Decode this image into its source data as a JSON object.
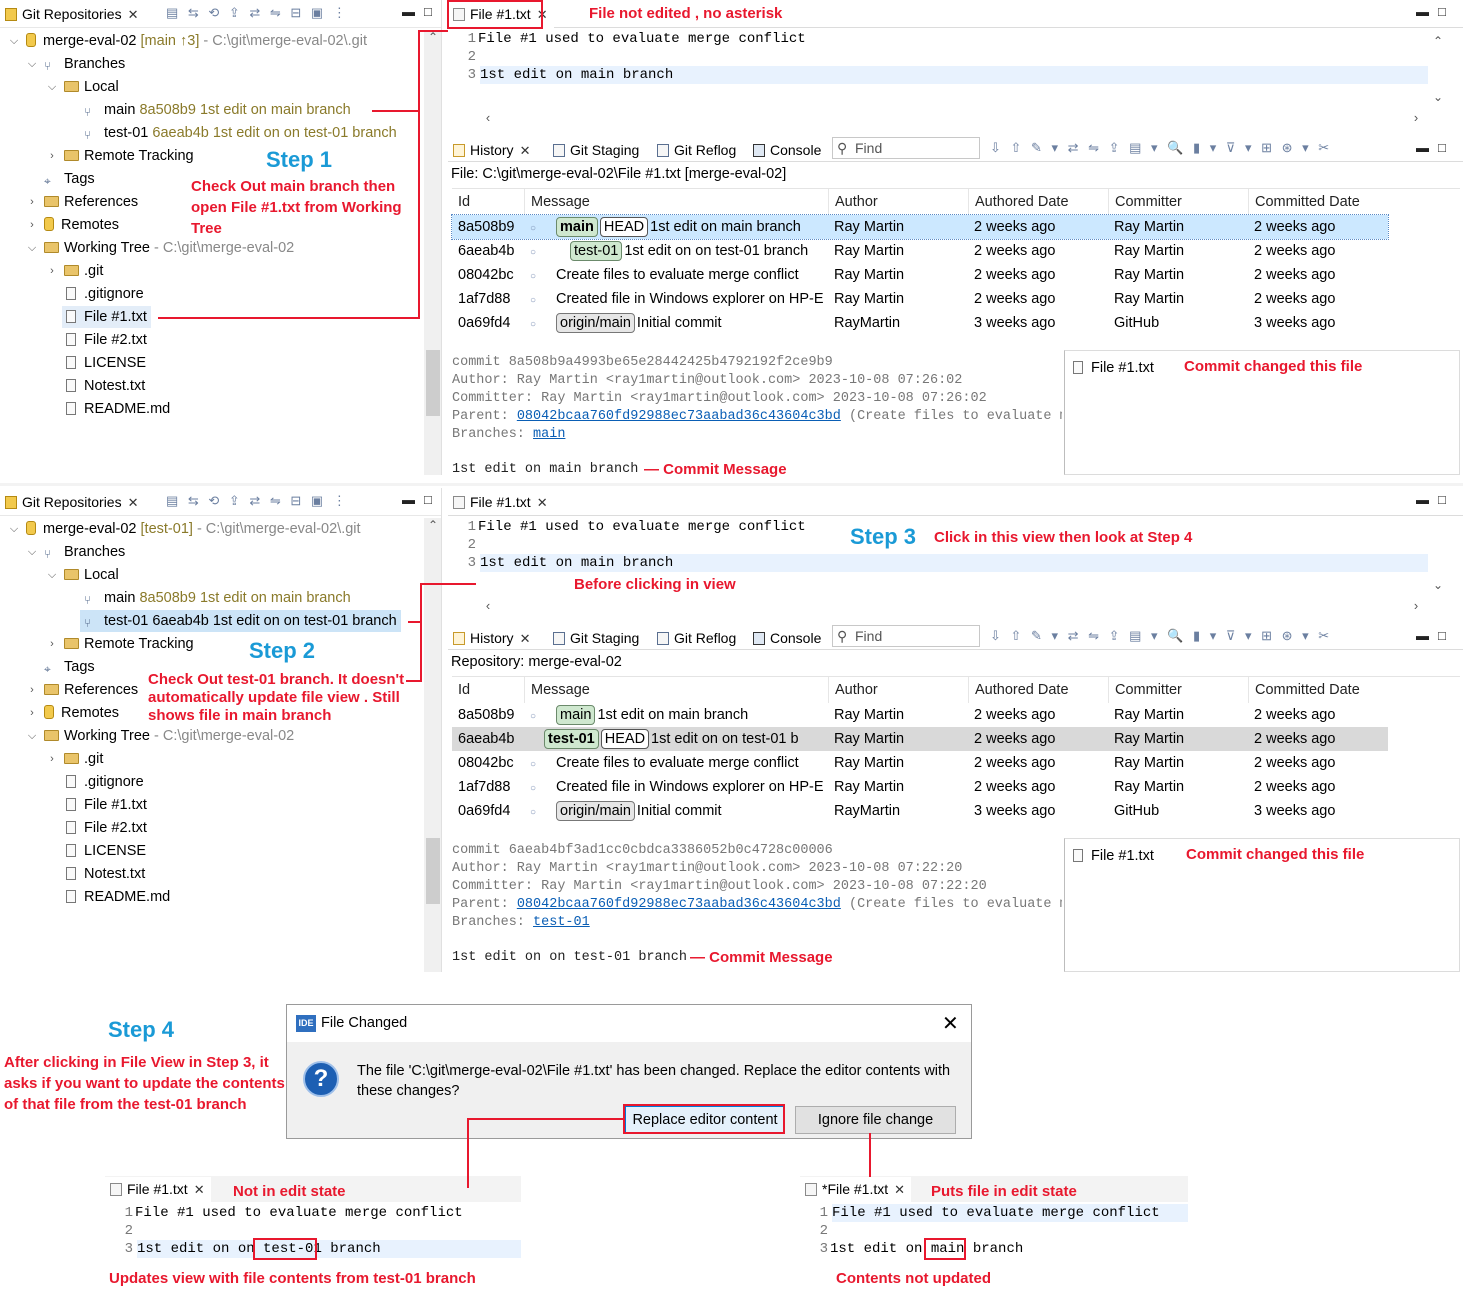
{
  "repos_panel": {
    "tab_label": "Git Repositories",
    "toolbar_icons": "▤ ⇆ ⟲ ⇪ ⇄ ⇋ ⊟ ▣ ⋮",
    "tree1": {
      "repo_name": "merge-eval-02",
      "repo_branch": "[main ↑3]",
      "repo_path": "- C:\\git\\merge-eval-02\\.git",
      "branches": "Branches",
      "local": "Local",
      "main_branch": "main",
      "main_info": "8a508b9 1st edit on main branch",
      "test_branch": "test-01",
      "test_info": "6aeab4b 1st edit on on test-01 branch",
      "remote_tracking": "Remote Tracking",
      "tags": "Tags",
      "references": "References",
      "remotes": "Remotes",
      "working_tree": "Working Tree",
      "working_tree_path": "- C:\\git\\merge-eval-02",
      "git_dir": ".git",
      "gitignore": ".gitignore",
      "file1": "File #1.txt",
      "file2": "File #2.txt",
      "license": "LICENSE",
      "notest": "Notest.txt",
      "readme": "README.md"
    },
    "tree2": {
      "repo_name": "merge-eval-02",
      "repo_branch": "[test-01]",
      "repo_path": "- C:\\git\\merge-eval-02\\.git",
      "branches": "Branches",
      "local": "Local",
      "main_branch": "main",
      "main_info": "8a508b9 1st edit on main branch",
      "test_branch": "test-01",
      "test_info": "6aeab4b 1st edit on on test-01 branch",
      "remote_tracking": "Remote Tracking",
      "tags": "Tags",
      "references": "References",
      "remotes": "Remotes",
      "working_tree": "Working Tree",
      "working_tree_path": "- C:\\git\\merge-eval-02",
      "git_dir": ".git",
      "gitignore": ".gitignore",
      "file1": "File #1.txt",
      "file2": "File #2.txt",
      "license": "LICENSE",
      "notest": "Notest.txt",
      "readme": "README.md"
    }
  },
  "editor": {
    "tab_label": "File #1.txt",
    "line_numbers": [
      "1",
      "2",
      "3"
    ],
    "line1": "File #1 used to evaluate merge conflict",
    "line2": "",
    "line3": "1st edit on main branch"
  },
  "history": {
    "tabs": {
      "history": "History",
      "staging": "Git Staging",
      "reflog": "Git Reflog",
      "console": "Console"
    },
    "find_placeholder": "Find",
    "toolbar_icons": "⇩ ⇧ ✎ ▾ ⇄ ⇋ ⇪ ▤ ▾ 🔍 ▮ ▾ ⊽ ▾ ⊞ ⊛ ▾ ✂",
    "columns": [
      "Id",
      "Message",
      "Author",
      "Authored Date",
      "Committer",
      "Committed Date"
    ],
    "top": {
      "scope": "File: C:\\git\\merge-eval-02\\File #1.txt [merge-eval-02]",
      "rows": [
        {
          "id": "8a508b9",
          "badges": [
            {
              "t": "main",
              "k": "b"
            },
            {
              "t": "HEAD",
              "k": "head"
            }
          ],
          "msg": "1st edit on main branch",
          "author": "Ray Martin",
          "adate": "2 weeks ago",
          "committer": "Ray Martin",
          "cdate": "2 weeks ago"
        },
        {
          "id": "6aeab4b",
          "badges": [
            {
              "t": "test-01",
              "k": ""
            }
          ],
          "msg": "1st edit on on test-01 branch",
          "author": "Ray Martin",
          "adate": "2 weeks ago",
          "committer": "Ray Martin",
          "cdate": "2 weeks ago"
        },
        {
          "id": "08042bc",
          "badges": [],
          "msg": "Create files to evaluate merge conflict",
          "author": "Ray Martin",
          "adate": "2 weeks ago",
          "committer": "Ray Martin",
          "cdate": "2 weeks ago"
        },
        {
          "id": "1af7d88",
          "badges": [],
          "msg": "Created file in Windows explorer on HP-E",
          "author": "Ray Martin",
          "adate": "2 weeks ago",
          "committer": "Ray Martin",
          "cdate": "2 weeks ago"
        },
        {
          "id": "0a69fd4",
          "badges": [
            {
              "t": "origin/main",
              "k": "gr"
            }
          ],
          "msg": "Initial commit",
          "author": "RayMartin",
          "adate": "3 weeks ago",
          "committer": "GitHub",
          "cdate": "3 weeks ago"
        }
      ],
      "commit": {
        "line1": "commit 8a508b9a4993be65e28442425b4792192f2ce9b9",
        "line2": "Author: Ray Martin <ray1martin@outlook.com> 2023-10-08 07:26:02",
        "line3": "Committer: Ray Martin <ray1martin@outlook.com> 2023-10-08 07:26:02",
        "parent_label": "Parent: ",
        "parent_hash": "08042bcaa760fd92988ec73aabad36c43604c3bd",
        "parent_desc": " (Create files to evaluate m",
        "branches_label": "Branches: ",
        "branch": "main",
        "message": "1st edit on main branch"
      },
      "changed_file": "File #1.txt"
    },
    "bottom": {
      "scope": "Repository: merge-eval-02",
      "rows": [
        {
          "id": "8a508b9",
          "badges": [
            {
              "t": "main",
              "k": ""
            }
          ],
          "msg": "1st edit on main branch",
          "author": "Ray Martin",
          "adate": "2 weeks ago",
          "committer": "Ray Martin",
          "cdate": "2 weeks ago"
        },
        {
          "id": "6aeab4b",
          "badges": [
            {
              "t": "test-01",
              "k": "b"
            },
            {
              "t": "HEAD",
              "k": "head"
            }
          ],
          "msg": "1st edit on on test-01 b",
          "author": "Ray Martin",
          "adate": "2 weeks ago",
          "committer": "Ray Martin",
          "cdate": "2 weeks ago"
        },
        {
          "id": "08042bc",
          "badges": [],
          "msg": "Create files to evaluate merge conflict",
          "author": "Ray Martin",
          "adate": "2 weeks ago",
          "committer": "Ray Martin",
          "cdate": "2 weeks ago"
        },
        {
          "id": "1af7d88",
          "badges": [],
          "msg": "Created file in Windows explorer on HP-E",
          "author": "Ray Martin",
          "adate": "2 weeks ago",
          "committer": "Ray Martin",
          "cdate": "2 weeks ago"
        },
        {
          "id": "0a69fd4",
          "badges": [
            {
              "t": "origin/main",
              "k": "gr"
            }
          ],
          "msg": "Initial commit",
          "author": "RayMartin",
          "adate": "3 weeks ago",
          "committer": "GitHub",
          "cdate": "3 weeks ago"
        }
      ],
      "commit": {
        "line1": "commit 6aeab4bf3ad1cc0cbdca3386052b0c4728c00006",
        "line2": "Author: Ray Martin <ray1martin@outlook.com> 2023-10-08 07:22:20",
        "line3": "Committer: Ray Martin <ray1martin@outlook.com> 2023-10-08 07:22:20",
        "parent_label": "Parent: ",
        "parent_hash": "08042bcaa760fd92988ec73aabad36c43604c3bd",
        "parent_desc": " (Create files to evaluate m",
        "branches_label": "Branches: ",
        "branch": "test-01",
        "message": "1st edit on on test-01 branch"
      },
      "changed_file": "File #1.txt"
    }
  },
  "annotations": {
    "not_edited": "File not edited , no asterisk",
    "step1": "Step 1",
    "step1_desc": "Check Out main branch then open File #1.txt from Working Tree",
    "commit_changed": "Commit changed this file",
    "commit_message": "— Commit Message",
    "step2": "Step 2",
    "step2_desc": "Check Out test-01 branch. It doesn't automatically update file view . Still shows file in main branch",
    "step3": "Step 3",
    "step3_desc": "Click in this view  then look at Step 4",
    "before_clicking": "Before clicking in view",
    "step4": "Step 4",
    "step4_desc": "After clicking in File View in Step 3, it asks if you want to update the contents of that file from the test-01 branch",
    "not_edit_state": "Not in edit state",
    "puts_edit_state": "Puts file in edit state",
    "updates_view": "Updates view with file contents from test-01 branch",
    "contents_not_updated": "Contents not updated"
  },
  "dialog": {
    "app_badge": "IDE",
    "title": "File Changed",
    "message": "The file 'C:\\git\\merge-eval-02\\File #1.txt' has been changed. Replace the editor contents with these changes?",
    "replace_button": "Replace editor content",
    "ignore_button": "Ignore file change"
  },
  "result_left": {
    "tab_label": "File #1.txt",
    "line1": "File #1 used to evaluate merge conflict",
    "line3_pre": "1st edit on on ",
    "line3_box": "test-01",
    "line3_post": " branch"
  },
  "result_right": {
    "tab_label": "*File #1.txt",
    "line1": "File #1 used to evaluate merge conflict",
    "line3_pre": "1st edit on ",
    "line3_box": "main",
    "line3_post": " branch"
  }
}
